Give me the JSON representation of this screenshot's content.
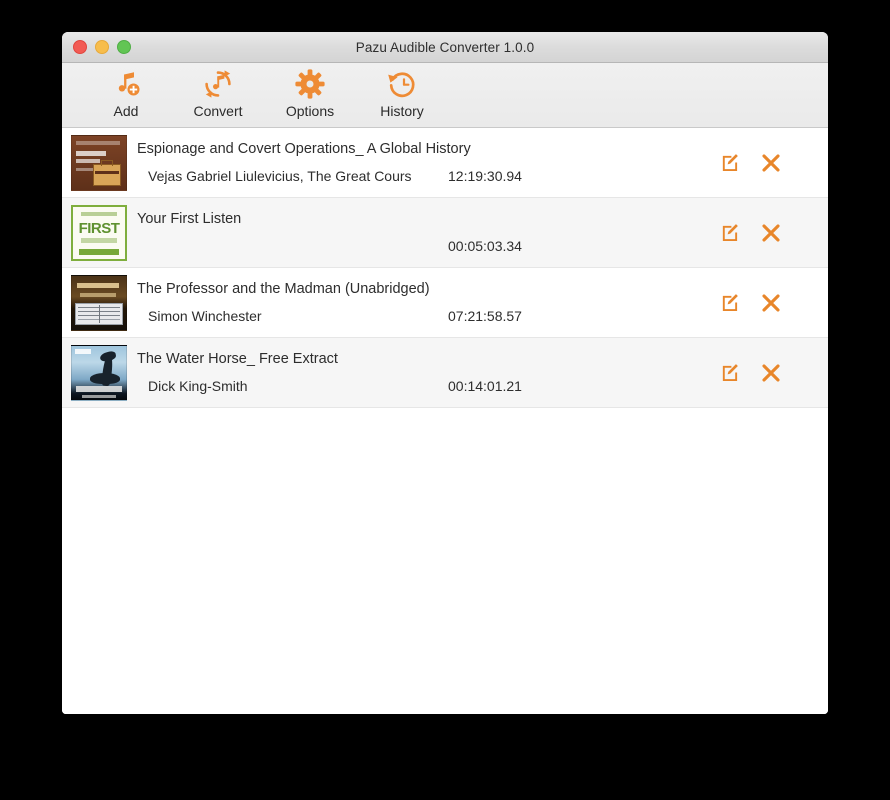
{
  "window": {
    "title": "Pazu Audible Converter 1.0.0",
    "accent_color": "#e8862a",
    "traffic_lights": {
      "close": "close-button",
      "minimize": "minimize-button",
      "zoom": "zoom-button"
    }
  },
  "toolbar": {
    "items": [
      {
        "label": "Add",
        "icon": "music-note-add-icon"
      },
      {
        "label": "Convert",
        "icon": "convert-refresh-icon"
      },
      {
        "label": "Options",
        "icon": "gear-icon"
      },
      {
        "label": "History",
        "icon": "clock-history-icon"
      }
    ]
  },
  "list": {
    "row_actions": {
      "edit": "edit-icon",
      "remove": "close-x-icon"
    },
    "rows": [
      {
        "title": "Espionage and Covert Operations_ A Global History",
        "author": "Vejas Gabriel Liulevicius, The Great Cours",
        "duration": "12:19:30.94",
        "cover": "cover-espionage"
      },
      {
        "title": "Your First Listen",
        "author": "",
        "duration": "00:05:03.34",
        "cover": "cover-first"
      },
      {
        "title": "The Professor and the Madman (Unabridged)",
        "author": "Simon Winchester",
        "duration": "07:21:58.57",
        "cover": "cover-professor"
      },
      {
        "title": "The Water Horse_ Free Extract",
        "author": "Dick King-Smith",
        "duration": "00:14:01.21",
        "cover": "cover-waterhorse"
      }
    ]
  }
}
